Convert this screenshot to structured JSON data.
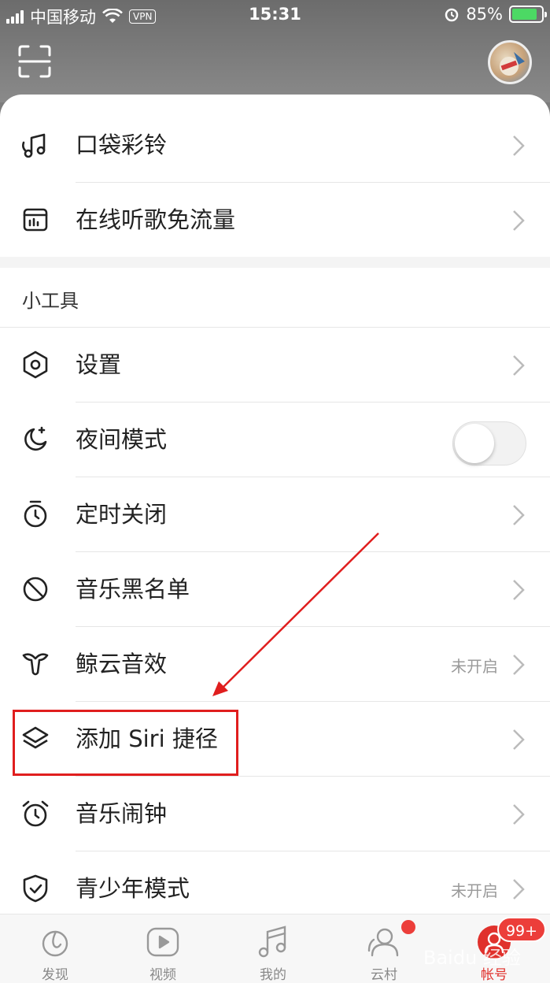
{
  "status_bar": {
    "carrier": "中国移动",
    "vpn": "VPN",
    "time": "15:31",
    "battery": "85%",
    "battery_level": 0.85
  },
  "header": {
    "scan_icon": "scan-icon",
    "avatar": "avatar"
  },
  "top_items": [
    {
      "label": "口袋彩铃",
      "icon": "ringtone-icon"
    },
    {
      "label": "在线听歌免流量",
      "icon": "data-free-icon"
    }
  ],
  "tools_section": {
    "title": "小工具",
    "items": [
      {
        "label": "设置",
        "icon": "settings-hex-icon"
      },
      {
        "label": "夜间模式",
        "icon": "moon-icon",
        "toggle": false
      },
      {
        "label": "定时关闭",
        "icon": "timer-icon"
      },
      {
        "label": "音乐黑名单",
        "icon": "block-icon"
      },
      {
        "label": "鲸云音效",
        "icon": "whale-icon",
        "status": "未开启"
      },
      {
        "label": "添加 Siri 捷径",
        "icon": "layers-icon"
      },
      {
        "label": "音乐闹钟",
        "icon": "alarm-icon"
      },
      {
        "label": "青少年模式",
        "icon": "shield-icon",
        "status": "未开启"
      }
    ]
  },
  "tabbar": {
    "tabs": [
      {
        "label": "发现",
        "icon": "discover-icon"
      },
      {
        "label": "视频",
        "icon": "video-icon"
      },
      {
        "label": "我的",
        "icon": "music-note-icon"
      },
      {
        "label": "云村",
        "icon": "users-icon"
      },
      {
        "label": "帐号",
        "icon": "account-icon"
      }
    ],
    "account_badge": "99+"
  },
  "watermark": "Baidu 经验",
  "colors": {
    "accent_red": "#e0312c",
    "annotation_red": "#e01e1e",
    "battery_green": "#4cd964"
  }
}
